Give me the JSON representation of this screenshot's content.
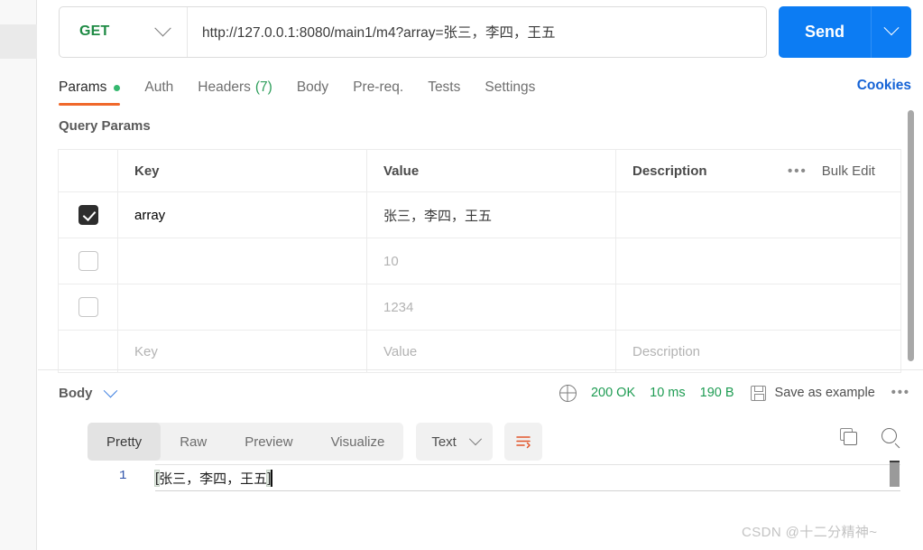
{
  "request": {
    "method": "GET",
    "url": "http://127.0.0.1:8080/main1/m4?array=张三，李四，王五",
    "send_label": "Send",
    "tabs": [
      {
        "label": "Params",
        "badge": "",
        "dot": true,
        "active": true
      },
      {
        "label": "Auth",
        "badge": "",
        "dot": false,
        "active": false
      },
      {
        "label": "Headers",
        "badge": "(7)",
        "dot": false,
        "active": false
      },
      {
        "label": "Body",
        "badge": "",
        "dot": false,
        "active": false
      },
      {
        "label": "Pre-req.",
        "badge": "",
        "dot": false,
        "active": false
      },
      {
        "label": "Tests",
        "badge": "",
        "dot": false,
        "active": false
      },
      {
        "label": "Settings",
        "badge": "",
        "dot": false,
        "active": false
      }
    ],
    "cookies_label": "Cookies"
  },
  "query_params": {
    "section_title": "Query Params",
    "columns": {
      "key": "Key",
      "value": "Value",
      "description": "Description",
      "bulk_edit": "Bulk Edit",
      "more": "•••"
    },
    "rows": [
      {
        "checked": true,
        "key": "array",
        "key_placeholder": "",
        "value": "张三，李四，王五",
        "value_placeholder": "",
        "description": "",
        "description_placeholder": "",
        "value_is_placeholder": false
      },
      {
        "checked": false,
        "key": "",
        "key_placeholder": "",
        "value": "",
        "value_placeholder": "10",
        "description": "",
        "description_placeholder": "",
        "value_is_placeholder": true
      },
      {
        "checked": false,
        "key": "",
        "key_placeholder": "",
        "value": "",
        "value_placeholder": "1234",
        "description": "",
        "description_placeholder": "",
        "value_is_placeholder": true
      },
      {
        "checked": false,
        "key": "",
        "key_placeholder": "Key",
        "value": "",
        "value_placeholder": "Value",
        "description": "",
        "description_placeholder": "Description",
        "value_is_placeholder": true
      }
    ]
  },
  "response": {
    "body_label": "Body",
    "status_code": "200 OK",
    "time": "10 ms",
    "size": "190 B",
    "save_as_example": "Save as example",
    "more": "•••",
    "view_tabs": [
      {
        "label": "Pretty",
        "active": true
      },
      {
        "label": "Raw",
        "active": false
      },
      {
        "label": "Preview",
        "active": false
      },
      {
        "label": "Visualize",
        "active": false
      }
    ],
    "format": "Text",
    "line_number": "1",
    "body_open_bracket": "[",
    "body_content": "张三，李四，王五",
    "body_close_bracket": "]"
  },
  "watermark": "CSDN @十二分精神~",
  "colors": {
    "accent_orange": "#f0682b",
    "send_blue": "#0c7cf3",
    "status_green": "#1e9c53",
    "method_green": "#1e8a44",
    "link_blue": "#1563d6"
  }
}
